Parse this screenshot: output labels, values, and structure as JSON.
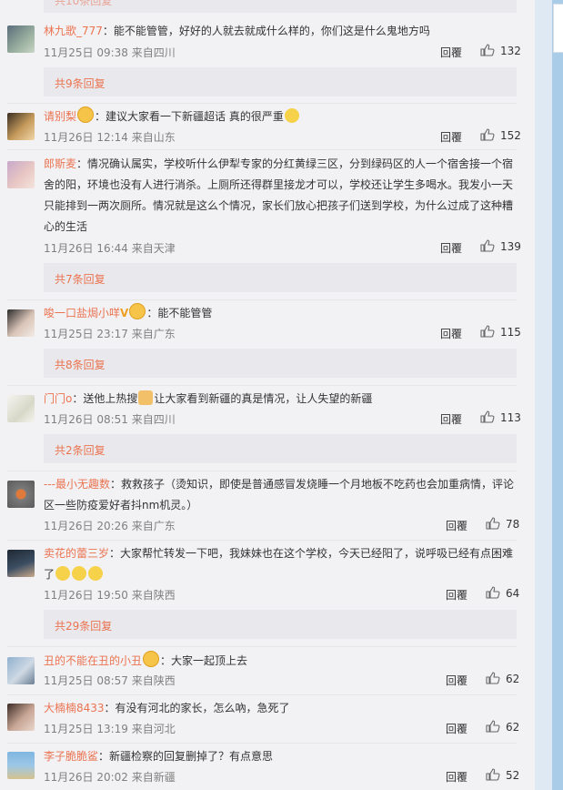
{
  "top_more": "共10条回复",
  "reply_label": "回覆",
  "comments": [
    {
      "name": "林九歌_777",
      "text": "：能不能管管，好好的人就去就成什么样的，你们这是什么鬼地方吗",
      "time": "11月25日 09:38",
      "loc": "来自四川",
      "likes": "132",
      "more": "共9条回复"
    },
    {
      "name": "请别梨",
      "text": "：建议大家看一下新疆超话 真的很严重",
      "time": "11月26日 12:14",
      "loc": "来自山东",
      "likes": "152"
    },
    {
      "name": "郎斯麦",
      "text_lines": [
        "：情况确认属实，学校听什么伊犁专家的分红黄绿三区，分到绿码区的人一个宿舍接一个宿",
        "舍的阳，环境也没有人进行消杀。上厕所还得群里接龙才可以，学校还让学生多喝水。我发小一天",
        "只能排到一两次厕所。情况就是这么个情况，家长们放心把孩子们送到学校，为什么过成了这种糟",
        "心的生活"
      ],
      "time": "11月26日 16:44",
      "loc": "来自天津",
      "likes": "139",
      "more": "共7条回复"
    },
    {
      "name": "唆一口盐焗小咩",
      "text": "：能不能管管",
      "time": "11月25日 23:17",
      "loc": "来自广东",
      "likes": "115",
      "more": "共8条回复"
    },
    {
      "name": "门门o",
      "text_a": "：送他上热搜",
      "text_b": "让大家看到新疆的真是情况，让人失望的新疆",
      "time": "11月26日 08:51",
      "loc": "来自四川",
      "likes": "113",
      "more": "共2条回复"
    },
    {
      "name": "---最小无趣数",
      "text_lines": [
        "：救救孩子（烫知识，即使是普通感冒发烧睡一个月地板不吃药也会加重病情，评论",
        "区一些防疫爱好者抖nm机灵。）"
      ],
      "time": "11月26日 20:26",
      "loc": "来自广东",
      "likes": "78"
    },
    {
      "name": "卖花的蕾三岁",
      "text_lines": [
        "：大家帮忙转发一下吧，我妹妹也在这个学校，今天已经阳了，说呼吸已经有点困难",
        "了"
      ],
      "time": "11月26日 19:50",
      "loc": "来自陕西",
      "likes": "64",
      "more": "共29条回复"
    },
    {
      "name": "丑的不能在丑的小丑",
      "text": "：大家一起顶上去",
      "time": "11月25日 08:57",
      "loc": "来自陕西",
      "likes": "62"
    },
    {
      "name": "大楠楠8433",
      "text": "：有没有河北的家长，怎么吶，急死了",
      "time": "11月25日 13:19",
      "loc": "来自河北",
      "likes": "62"
    },
    {
      "name": "李子脆脆鲨",
      "text": "：新疆检察的回复删掉了？有点意思",
      "time": "11月26日 20:02",
      "loc": "来自新疆",
      "likes": "52"
    }
  ],
  "colors": {
    "name": "#eb7350",
    "meta": "#808080",
    "more_bg": "#e9e9ed",
    "page_bg": "#f2f2f5"
  }
}
